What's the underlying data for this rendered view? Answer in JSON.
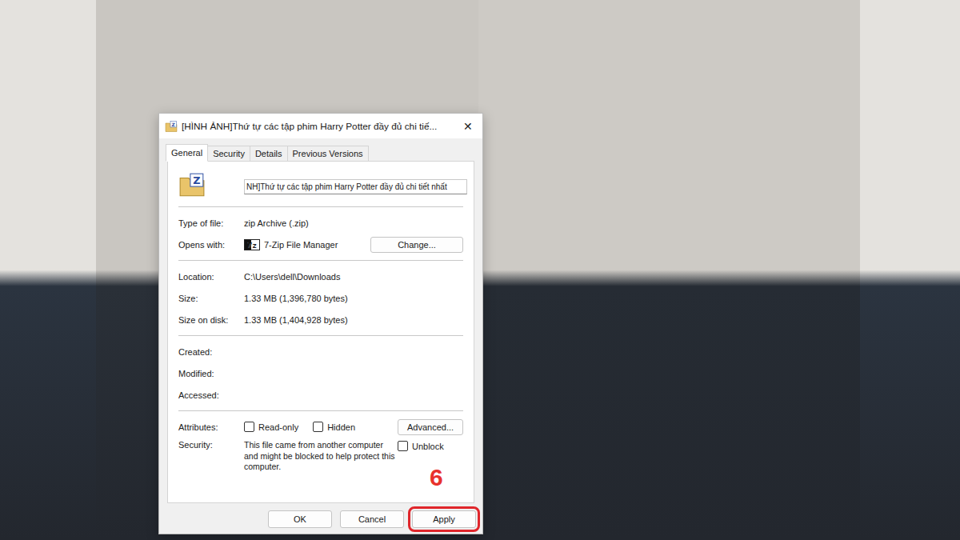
{
  "window": {
    "title": "[HÌNH ẢNH]Thứ tự các tập phim Harry Potter đầy đủ chi tiế...",
    "close": "✕",
    "icon_label": "Z"
  },
  "tabs": [
    {
      "label": "General",
      "selected": true
    },
    {
      "label": "Security",
      "selected": false
    },
    {
      "label": "Details",
      "selected": false
    },
    {
      "label": "Previous Versions",
      "selected": false
    }
  ],
  "file": {
    "icon_label": "Z",
    "name": "NH]Thứ tự các tập phim Harry Potter đầy đủ chi tiết nhất"
  },
  "sections": [
    [
      {
        "kind": "text",
        "label": "Type of file:",
        "value": "zip Archive (.zip)"
      },
      {
        "kind": "app",
        "label": "Opens with:",
        "value": "7-Zip File Manager",
        "icon_label": "7z",
        "button": "Change..."
      }
    ],
    [
      {
        "kind": "text",
        "label": "Location:",
        "value": "C:\\Users\\dell\\Downloads"
      },
      {
        "kind": "text",
        "label": "Size:",
        "value": "1.33 MB (1,396,780 bytes)"
      },
      {
        "kind": "text",
        "label": "Size on disk:",
        "value": "1.33 MB (1,404,928 bytes)"
      }
    ],
    [
      {
        "kind": "text",
        "label": "Created:",
        "value": ""
      },
      {
        "kind": "text",
        "label": "Modified:",
        "value": ""
      },
      {
        "kind": "text",
        "label": "Accessed:",
        "value": ""
      }
    ]
  ],
  "attributes": {
    "label": "Attributes:",
    "checkboxes": [
      {
        "label": "Read-only",
        "checked": false
      },
      {
        "label": "Hidden",
        "checked": false
      }
    ],
    "button": "Advanced..."
  },
  "security": {
    "label": "Security:",
    "text": "This file came from another computer and might be blocked to help protect this computer.",
    "checkbox": {
      "label": "Unblock",
      "checked": false
    }
  },
  "buttons": [
    {
      "label": "OK",
      "highlighted": false
    },
    {
      "label": "Cancel",
      "highlighted": false
    },
    {
      "label": "Apply",
      "highlighted": true
    }
  ],
  "annotation": {
    "label": "6"
  }
}
